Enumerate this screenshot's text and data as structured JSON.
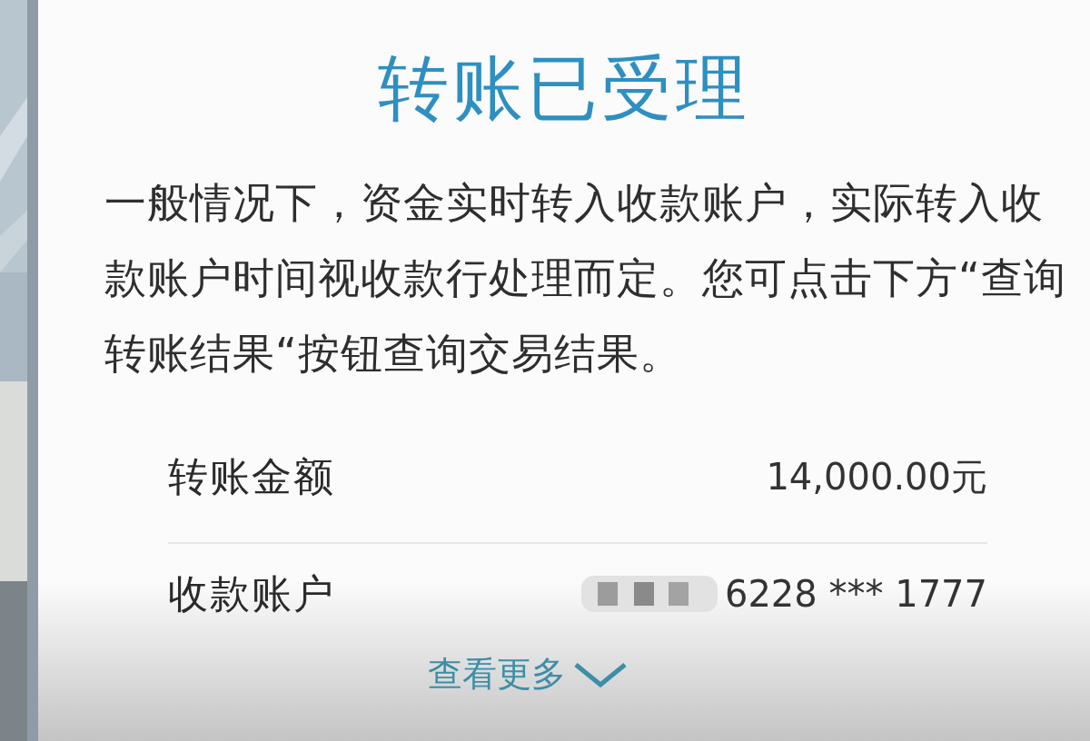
{
  "title": "转账已受理",
  "notice": "一般情况下，资金实时转入收款账户，实际转入收款账户时间视收款行处理而定。您可点击下方“查询转账结果“按钮查询交易结果。",
  "details": [
    {
      "label": "转账金额",
      "value": "14,000.00元",
      "masked": false
    },
    {
      "label": "收款账户",
      "value": "6228 *** 1777",
      "masked": true
    }
  ],
  "more_link": "查看更多"
}
